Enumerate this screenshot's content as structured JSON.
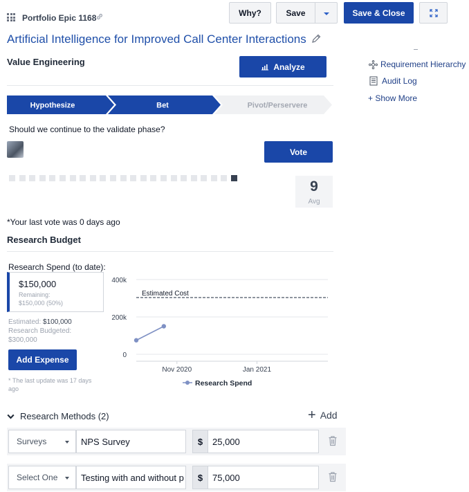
{
  "header": {
    "epic_id": "Portfolio Epic 1168",
    "why_label": "Why?",
    "save_label": "Save",
    "save_close_label": "Save & Close"
  },
  "title": "Artificial Intelligence for Improved Call Center Interactions",
  "value_engineering": {
    "label": "Value Engineering",
    "analyze_label": "Analyze"
  },
  "sidebar": {
    "items": [
      {
        "label": "Requirement Hierarchy",
        "icon": "hierarchy-icon"
      },
      {
        "label": "Audit Log",
        "icon": "document-icon"
      },
      {
        "label": "+ Show More",
        "icon": ""
      }
    ]
  },
  "stages": [
    {
      "label": "Hypothesize",
      "state": "done"
    },
    {
      "label": "Bet",
      "state": "active"
    },
    {
      "label": "Pivot/Perservere",
      "state": "pending"
    }
  ],
  "vote": {
    "question": "Should we continue to the validate phase?",
    "button_label": "Vote",
    "scale_count": 10,
    "selected": 10,
    "average": "9",
    "average_label": "Avg",
    "last_vote_text": "*Your last vote was 0 days ago"
  },
  "research_budget": {
    "title": "Research Budget",
    "spend_label": "Research Spend (to date):",
    "spend_amount": "$150,000",
    "remaining_label": "Remaining:",
    "remaining_value": "$150,000 (50%)",
    "estimated_label": "Estimated:",
    "estimated_value": "$100,000",
    "budgeted_label": "Research Budgeted:",
    "budgeted_value": "$300,000",
    "add_expense_label": "Add Expense",
    "last_update_text": "* The last update was 17 days ago"
  },
  "chart_data": {
    "type": "line",
    "x_ticks": [
      "Nov 2020",
      "Jan 2021"
    ],
    "y_ticks": [
      "400k",
      "200k",
      "0"
    ],
    "ylim": [
      0,
      400000
    ],
    "series": [
      {
        "name": "Research Spend",
        "color": "#7f91c4",
        "points": [
          {
            "x": "2020-10-01",
            "y": 75000
          },
          {
            "x": "2020-10-22",
            "y": 150000
          }
        ]
      }
    ],
    "annotations": [
      {
        "label": "Estimated Cost",
        "y": 300000,
        "style": "dashed"
      }
    ],
    "legend_position": "bottom",
    "grid": true
  },
  "research_methods": {
    "title": "Research Methods (2)",
    "add_label": "Add",
    "rows": [
      {
        "type": "Surveys",
        "name": "NPS Survey",
        "currency": "$",
        "amount": "25,000"
      },
      {
        "type": "Select One",
        "name": "Testing with and without p",
        "currency": "$",
        "amount": "75,000"
      }
    ]
  },
  "colors": {
    "primary": "#1a47a8",
    "title": "#1f4fa9",
    "pending_stage": "#f0f1f3"
  }
}
